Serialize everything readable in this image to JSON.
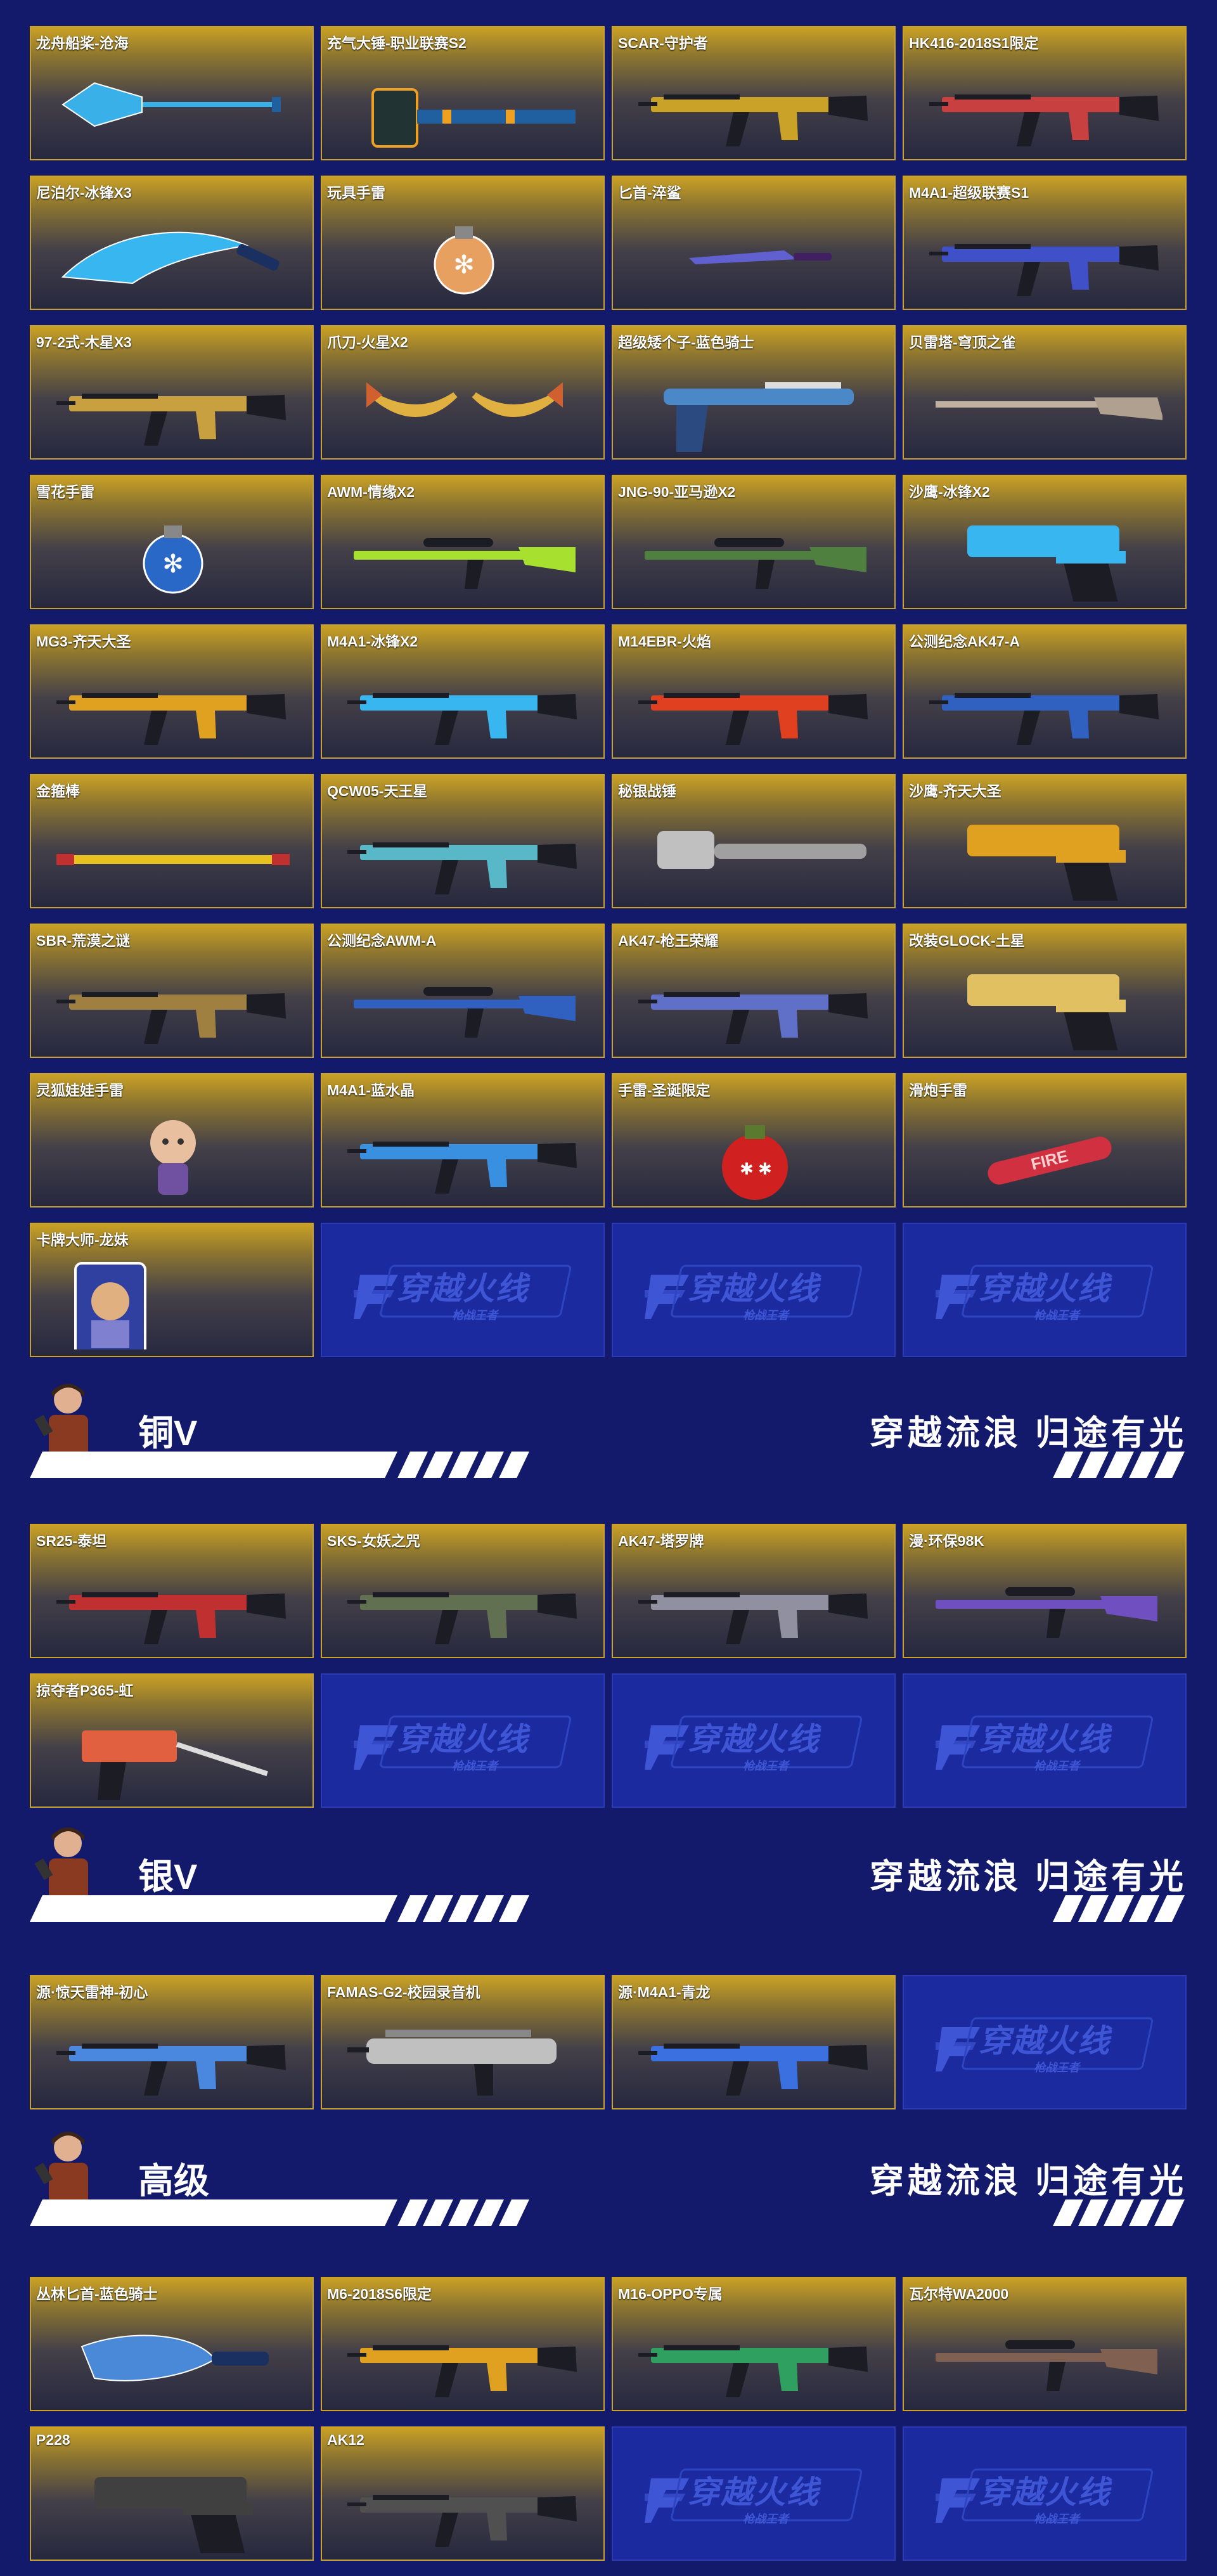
{
  "logo_cell": {
    "title": "穿越火线",
    "subtitle": "枪战王者"
  },
  "sections": [
    {
      "id": "sec0",
      "items": [
        {
          "name": "龙舟船桨-沧海",
          "art": "paddle",
          "color": "#3ab0e8"
        },
        {
          "name": "充气大锤-职业联赛S2",
          "art": "hammer",
          "color": "#f0a020"
        },
        {
          "name": "SCAR-守护者",
          "art": "rifle",
          "color": "#c9a227"
        },
        {
          "name": "HK416-2018S1限定",
          "art": "rifle",
          "color": "#c84040"
        },
        {
          "name": "尼泊尔-冰锋X3",
          "art": "blade",
          "color": "#38b6f0"
        },
        {
          "name": "玩具手雷",
          "art": "grenade",
          "color": "#e8a060"
        },
        {
          "name": "匕首-淬鲨",
          "art": "knife",
          "color": "#6060d0"
        },
        {
          "name": "M4A1-超级联赛S1",
          "art": "rifle",
          "color": "#4050c8"
        },
        {
          "name": "97-2式-木星X3",
          "art": "rifle",
          "color": "#c8a040"
        },
        {
          "name": "爪刀-火星X2",
          "art": "claws",
          "color": "#e0b040"
        },
        {
          "name": "超级矮个子-蓝色骑士",
          "art": "shotgun",
          "color": "#4a88c8"
        },
        {
          "name": "贝雷塔-穹顶之雀",
          "art": "longgun",
          "color": "#b0a090"
        },
        {
          "name": "雪花手雷",
          "art": "grenade",
          "color": "#2a68c8"
        },
        {
          "name": "AWM-情缘X2",
          "art": "sniper",
          "color": "#a8e030"
        },
        {
          "name": "JNG-90-亚马逊X2",
          "art": "sniper",
          "color": "#508040"
        },
        {
          "name": "沙鹰-冰锋X2",
          "art": "pistol",
          "color": "#38b6f0"
        },
        {
          "name": "MG3-齐天大圣",
          "art": "rifle",
          "color": "#e0a020"
        },
        {
          "name": "M4A1-冰锋X2",
          "art": "rifle",
          "color": "#38b6f0"
        },
        {
          "name": "M14EBR-火焰",
          "art": "rifle",
          "color": "#e04020"
        },
        {
          "name": "公测纪念AK47-A",
          "art": "rifle",
          "color": "#3060c0"
        },
        {
          "name": "金箍棒",
          "art": "staff",
          "color": "#e8c020"
        },
        {
          "name": "QCW05-天王星",
          "art": "rifle",
          "color": "#58b8c8"
        },
        {
          "name": "秘银战锤",
          "art": "warhammer",
          "color": "#c0c0c0"
        },
        {
          "name": "沙鹰-齐天大圣",
          "art": "pistol",
          "color": "#e0a020"
        },
        {
          "name": "SBR-荒漠之谜",
          "art": "rifle",
          "color": "#a08040"
        },
        {
          "name": "公测纪念AWM-A",
          "art": "sniper",
          "color": "#3060c0"
        },
        {
          "name": "AK47-枪王荣耀",
          "art": "rifle",
          "color": "#6070c8"
        },
        {
          "name": "改装GLOCK-土星",
          "art": "pistol",
          "color": "#e0c060"
        },
        {
          "name": "灵狐娃娃手雷",
          "art": "doll",
          "color": "#e8c0a0"
        },
        {
          "name": "M4A1-蓝水晶",
          "art": "rifle",
          "color": "#3a90e0"
        },
        {
          "name": "手雷-圣诞限定",
          "art": "ornament",
          "color": "#d02020"
        },
        {
          "name": "滑炮手雷",
          "art": "tube",
          "color": "#d03040"
        },
        {
          "name": "卡牌大师-龙妹",
          "art": "card",
          "color": "#8080d0"
        }
      ]
    },
    {
      "id": "sec1",
      "tier": "铜V",
      "slogan": "穿越流浪 归途有光",
      "items": [
        {
          "name": "SR25-泰坦",
          "art": "rifle",
          "color": "#c03030"
        },
        {
          "name": "SKS-女妖之咒",
          "art": "rifle",
          "color": "#607050"
        },
        {
          "name": "AK47-塔罗牌",
          "art": "rifle",
          "color": "#9090a0"
        },
        {
          "name": "漫·环保98K",
          "art": "sniper",
          "color": "#7050c0"
        },
        {
          "name": "掠夺者P365-虹",
          "art": "smg",
          "color": "#e06040"
        }
      ]
    },
    {
      "id": "sec2",
      "tier": "银V",
      "slogan": "穿越流浪 归途有光",
      "items": [
        {
          "name": "源·惊天雷神-初心",
          "art": "rifle",
          "color": "#4a88e0"
        },
        {
          "name": "FAMAS-G2-校园录音机",
          "art": "bullpup",
          "color": "#c0c0c0"
        },
        {
          "name": "源·M4A1-青龙",
          "art": "rifle",
          "color": "#3a70e0"
        }
      ]
    },
    {
      "id": "sec3",
      "tier": "高级",
      "slogan": "穿越流浪 归途有光",
      "items": [
        {
          "name": "丛林匕首-蓝色骑士",
          "art": "machete",
          "color": "#4a88d8"
        },
        {
          "name": "M6-2018S6限定",
          "art": "rifle",
          "color": "#e0a020"
        },
        {
          "name": "M16-OPPO专属",
          "art": "rifle",
          "color": "#30a060"
        },
        {
          "name": "瓦尔特WA2000",
          "art": "sniper",
          "color": "#806050"
        },
        {
          "name": "P228",
          "art": "pistol",
          "color": "#404040"
        },
        {
          "name": "AK12",
          "art": "rifle",
          "color": "#505050"
        }
      ]
    }
  ]
}
